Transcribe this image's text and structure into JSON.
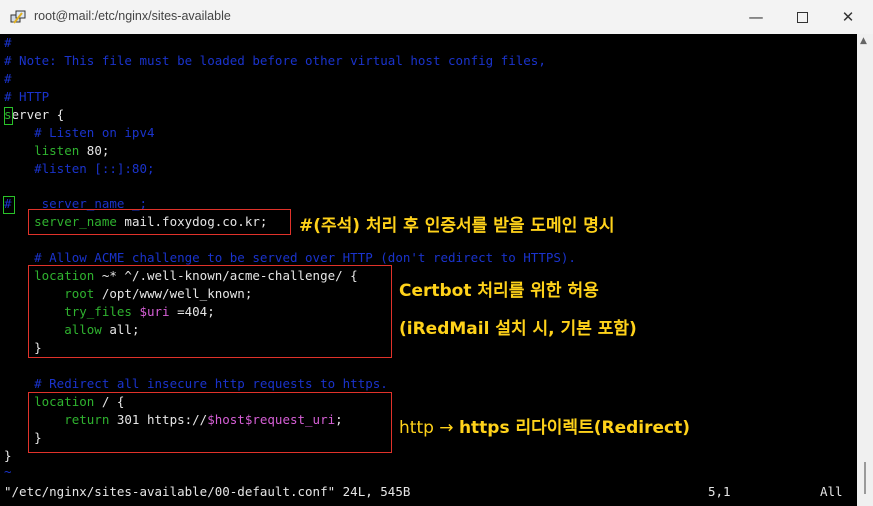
{
  "window": {
    "title": "root@mail:/etc/nginx/sites-available",
    "icons": [
      "putty-icon",
      "minimize-icon",
      "maximize-icon",
      "close-icon"
    ]
  },
  "editor": {
    "lines": {
      "l1": "#",
      "l2": "# Note: This file must be loaded before other virtual host config files,",
      "l3": "#",
      "l4": "# HTTP",
      "l5_a": "s",
      "l5_b": "erver {",
      "l6": "    # Listen on ipv4",
      "l7_a": "    listen",
      "l7_b": " 80;",
      "l8": "    #listen [::]:80;",
      "l9": "",
      "l10_a": "#",
      "l10_b": "    server_name _;",
      "l11_a": "    server_name",
      "l11_b": " mail.foxydog.co.kr;",
      "l12": "",
      "l13": "    # Allow ACME challenge to be served over HTTP (don't redirect to HTTPS).",
      "l14_a": "    location",
      "l14_b": " ~* ^/.well-known/acme-challenge/ {",
      "l15_a": "        root",
      "l15_b": " /opt/www/well_known;",
      "l16_a": "        try_files",
      "l16_b": " $uri",
      "l16_c": " =404;",
      "l17_a": "        allow",
      "l17_b": " all;",
      "l18": "    }",
      "l19": "",
      "l20": "    # Redirect all insecure http requests to https.",
      "l21_a": "    location",
      "l21_b": " / {",
      "l22_a": "        return",
      "l22_b": " 301 https://",
      "l22_c": "$host$request_uri",
      "l22_d": ";",
      "l23": "    }",
      "l24": "}",
      "l25": "~"
    },
    "status_left": "\"/etc/nginx/sites-available/00-default.conf\" 24L, 545B",
    "status_pos": "5,1",
    "status_scroll": "All"
  },
  "annotations": {
    "a1": "#(주석) 처리 후 인증서를 받을 도메인 명시",
    "a2": "Certbot 처리를 위한 허용",
    "a3": "(iRedMail 설치 시, 기본 포함)",
    "a4_a": "http → ",
    "a4_b": "https 리다이렉트(Redirect)"
  },
  "colors": {
    "comment": "#1a33cc",
    "keyword": "#2fb22f",
    "variable": "#d65fd6",
    "highlight_box": "#e0322a",
    "annotation": "#ffd21a"
  }
}
